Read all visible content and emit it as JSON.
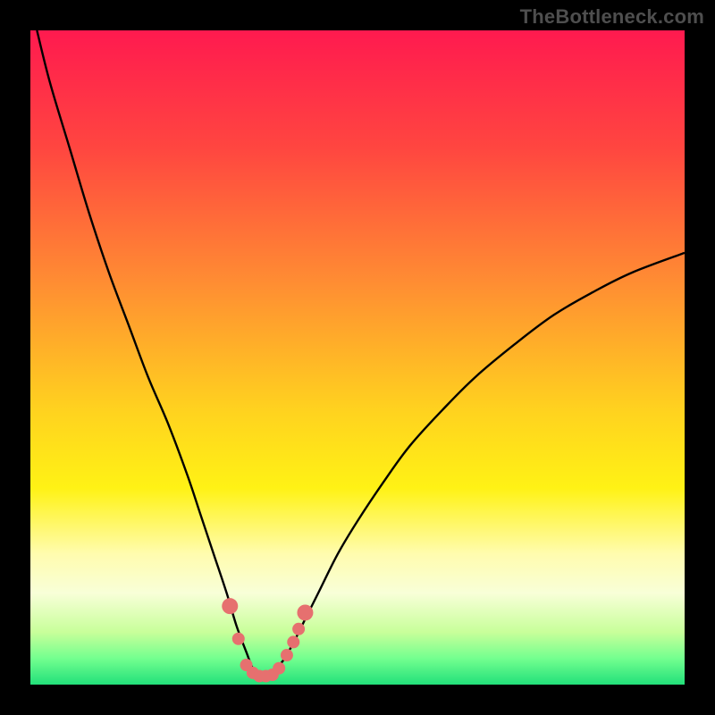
{
  "watermark": "TheBottleneck.com",
  "chart_data": {
    "type": "line",
    "title": "",
    "xlabel": "",
    "ylabel": "",
    "xlim": [
      0,
      100
    ],
    "ylim": [
      0,
      100
    ],
    "background_gradient": {
      "stops": [
        {
          "offset": 0.0,
          "color": "#ff1a4f"
        },
        {
          "offset": 0.18,
          "color": "#ff4640"
        },
        {
          "offset": 0.38,
          "color": "#ff8b33"
        },
        {
          "offset": 0.58,
          "color": "#ffd21f"
        },
        {
          "offset": 0.7,
          "color": "#fff215"
        },
        {
          "offset": 0.8,
          "color": "#fffcae"
        },
        {
          "offset": 0.86,
          "color": "#f8ffd8"
        },
        {
          "offset": 0.92,
          "color": "#c8ff9a"
        },
        {
          "offset": 0.96,
          "color": "#73ff8f"
        },
        {
          "offset": 1.0,
          "color": "#22e07a"
        }
      ]
    },
    "series": [
      {
        "name": "bottleneck-curve",
        "color": "#000000",
        "x": [
          1,
          3,
          6,
          9,
          12,
          15,
          18,
          21,
          24,
          26,
          28,
          30,
          31.5,
          33,
          34,
          35,
          35.5,
          36,
          37,
          38.5,
          40,
          42,
          44,
          47,
          50,
          54,
          58,
          63,
          68,
          74,
          80,
          86,
          92,
          100
        ],
        "values": [
          100,
          92,
          82,
          72,
          63,
          55,
          47,
          40,
          32,
          26,
          20,
          14,
          9,
          5,
          2.5,
          1.5,
          1.3,
          1.5,
          2,
          3.5,
          6,
          10,
          14,
          20,
          25,
          31,
          36.5,
          42,
          47,
          52,
          56.5,
          60,
          63,
          66
        ]
      }
    ],
    "markers": {
      "color": "#e6706f",
      "radius_large": 9,
      "radius_small": 7,
      "points_xy": [
        [
          30.5,
          12.0
        ],
        [
          31.8,
          7.0
        ],
        [
          33.0,
          3.0
        ],
        [
          34.0,
          1.8
        ],
        [
          35.0,
          1.3
        ],
        [
          36.0,
          1.3
        ],
        [
          37.0,
          1.5
        ],
        [
          38.0,
          2.5
        ],
        [
          39.2,
          4.5
        ],
        [
          40.2,
          6.5
        ],
        [
          41.0,
          8.5
        ],
        [
          42.0,
          11.0
        ]
      ],
      "large_indices": [
        0,
        11
      ]
    }
  }
}
